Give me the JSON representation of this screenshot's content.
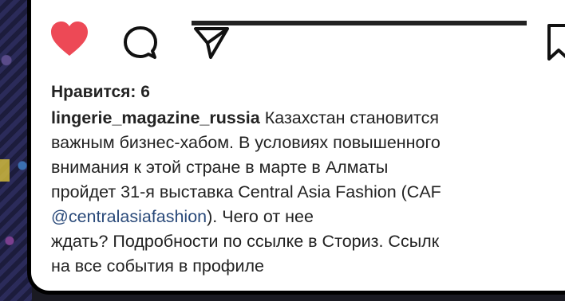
{
  "post": {
    "likes": "Нравится: 6",
    "username": "lingerie_magazine_russia",
    "caption_lines": [
      "Казахстан становится",
      "важным бизнес-хабом. В условиях повышенного",
      "внимания к этой стране в марте в Алматы",
      "пройдет 31-я выставка Central Asia Fashion (CAF",
      "). Чего от нее",
      "ждать? Подробности по ссылке в Сториз. Ссылк",
      "на все события в профиле"
    ],
    "mention": "@centralasiafashion"
  },
  "actions": {
    "like_icon": "heart-filled-icon",
    "comment_icon": "comment-bubble-icon",
    "share_icon": "paper-plane-icon",
    "save_icon": "bookmark-icon",
    "like_color": "#ed4956"
  }
}
